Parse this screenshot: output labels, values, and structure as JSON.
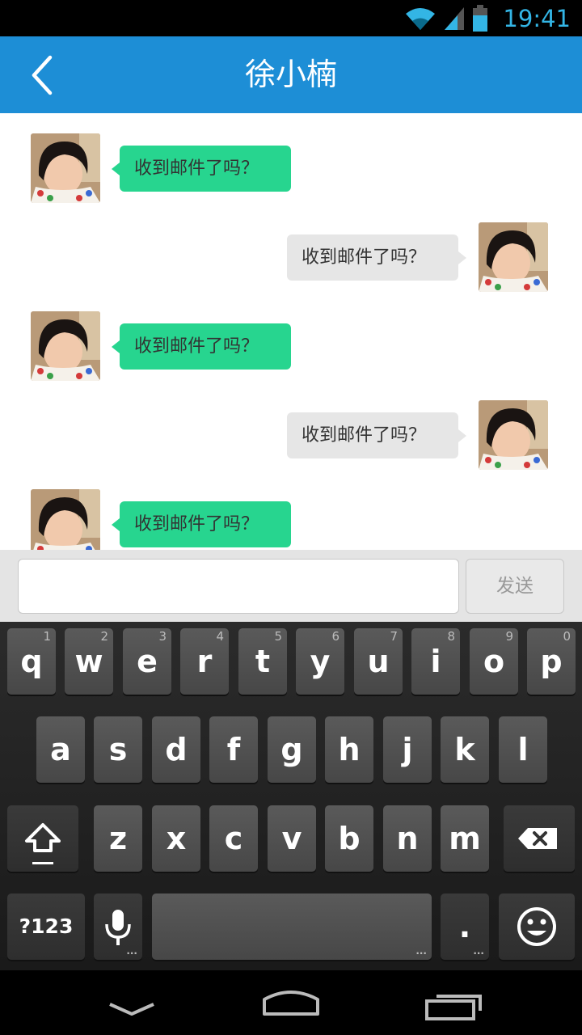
{
  "status_bar": {
    "time": "19:41",
    "icons": [
      "wifi-icon",
      "signal-icon",
      "battery-icon"
    ],
    "accent_color": "#33b5e5"
  },
  "header": {
    "title": "徐小楠",
    "back_icon": "chevron-left-icon",
    "background": "#1d8ed6"
  },
  "messages": [
    {
      "direction": "incoming",
      "text": "收到邮件了吗？"
    },
    {
      "direction": "outgoing",
      "text": "收到邮件了吗？"
    },
    {
      "direction": "incoming",
      "text": "收到邮件了吗？"
    },
    {
      "direction": "outgoing",
      "text": "收到邮件了吗？"
    },
    {
      "direction": "incoming",
      "text": "收到邮件了吗？"
    }
  ],
  "bubble_colors": {
    "incoming": "#27d58f",
    "outgoing": "#e6e6e6"
  },
  "composer": {
    "input_value": "",
    "send_label": "发送"
  },
  "keyboard": {
    "row1": [
      {
        "key": "q",
        "hint": "1"
      },
      {
        "key": "w",
        "hint": "2"
      },
      {
        "key": "e",
        "hint": "3"
      },
      {
        "key": "r",
        "hint": "4"
      },
      {
        "key": "t",
        "hint": "5"
      },
      {
        "key": "y",
        "hint": "6"
      },
      {
        "key": "u",
        "hint": "7"
      },
      {
        "key": "i",
        "hint": "8"
      },
      {
        "key": "o",
        "hint": "9"
      },
      {
        "key": "p",
        "hint": "0"
      }
    ],
    "row2": [
      "a",
      "s",
      "d",
      "f",
      "g",
      "h",
      "j",
      "k",
      "l"
    ],
    "row3": [
      "z",
      "x",
      "c",
      "v",
      "b",
      "n",
      "m"
    ],
    "symbols_label": "?123",
    "period_label": "."
  },
  "nav_bar": {
    "icons": [
      "back-nav-icon",
      "home-icon",
      "recents-icon"
    ]
  }
}
